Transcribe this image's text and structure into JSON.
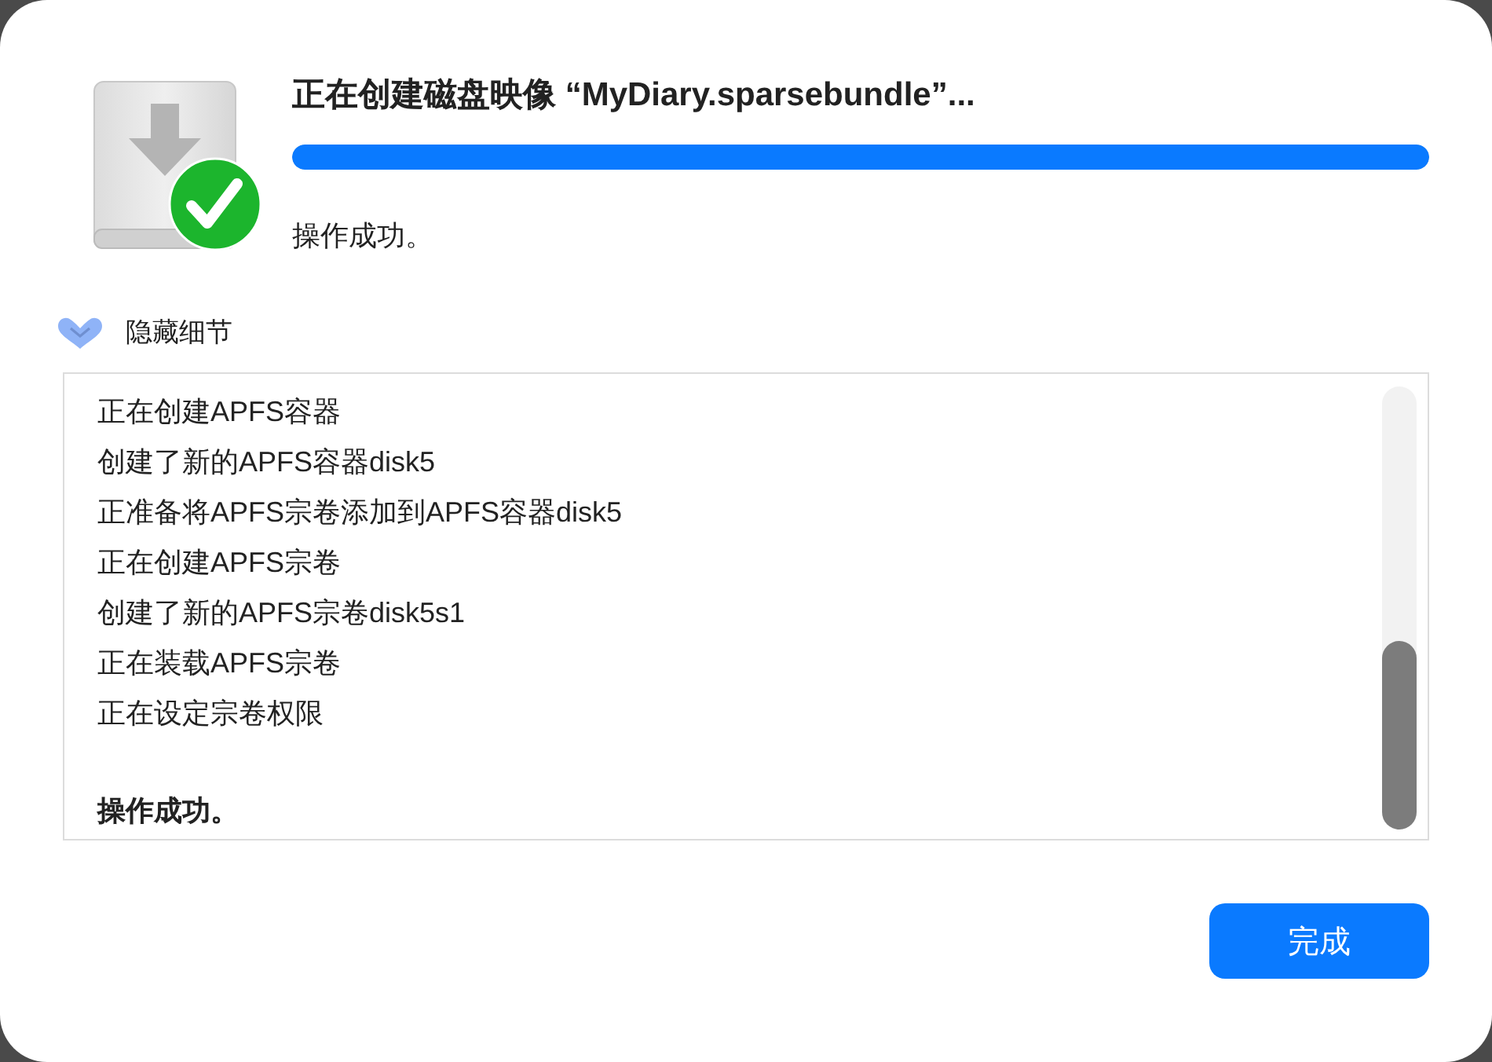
{
  "dialog": {
    "title": "正在创建磁盘映像 “MyDiary.sparsebundle”...",
    "progress": {
      "level": 1
    },
    "status": "操作成功。"
  },
  "details": {
    "toggle_label": "隐藏细节",
    "expanded": true,
    "log": [
      {
        "text": "正在创建APFS容器",
        "kind": "line"
      },
      {
        "text": "创建了新的APFS容器disk5",
        "kind": "line"
      },
      {
        "text": "正准备将APFS宗卷添加到APFS容器disk5",
        "kind": "line"
      },
      {
        "text": "正在创建APFS宗卷",
        "kind": "line"
      },
      {
        "text": "创建了新的APFS宗卷disk5s1",
        "kind": "line"
      },
      {
        "text": "正在装载APFS宗卷",
        "kind": "line"
      },
      {
        "text": "正在设定宗卷权限",
        "kind": "line"
      },
      {
        "text": "操作成功。",
        "kind": "summary"
      }
    ]
  },
  "buttons": [
    {
      "label": "完成",
      "kind": "primary"
    }
  ]
}
